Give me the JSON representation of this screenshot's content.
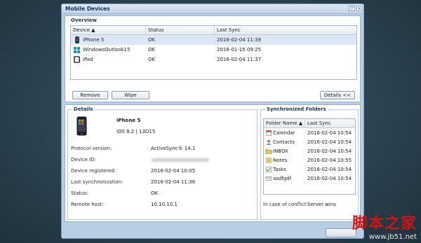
{
  "window": {
    "title": "Mobile Devices",
    "help_glyph": "?",
    "close_glyph": "×"
  },
  "overview": {
    "legend": "Overview",
    "columns": [
      "Device ▲",
      "Status",
      "Last Sync"
    ],
    "rows": [
      {
        "device": "iPhone 5",
        "status": "OK",
        "last_sync": "2016-02-04 11:39",
        "icon": "phone-icon"
      },
      {
        "device": "WindowsOutlook15",
        "status": "OK",
        "last_sync": "2016-01-15 09:25",
        "icon": "windows-icon"
      },
      {
        "device": "iPad",
        "status": "OK",
        "last_sync": "2016-02-04 11:37",
        "icon": "tablet-icon"
      }
    ],
    "remove_label": "Remove",
    "wipe_label": "Wipe",
    "details_label": "Details <<"
  },
  "details": {
    "legend": "Details",
    "device_name": "iPhone 5",
    "os": "iOS 8.2 | 13D15",
    "fields": [
      {
        "label": "Protocol version:",
        "value": "ActiveSync® 14.1"
      },
      {
        "label": "Device ID:",
        "value": ""
      },
      {
        "label": "Device registered:",
        "value": "2016-02-04 10:05"
      },
      {
        "label": "Last synchronization:",
        "value": "2016-02-04 11:38"
      },
      {
        "label": "Status:",
        "value": "OK"
      },
      {
        "label": "Remote host:",
        "value": "10.10.10.1"
      }
    ]
  },
  "sync_folders": {
    "legend": "Synchronized Folders",
    "columns": [
      "Folder Name ▲",
      "Last Sync"
    ],
    "rows": [
      {
        "name": "Calendar",
        "last_sync": "2016-02-04 10:54",
        "icon": "calendar-icon"
      },
      {
        "name": "Contacts",
        "last_sync": "2016-02-04 10:54",
        "icon": "contacts-icon"
      },
      {
        "name": "INBOX",
        "last_sync": "2016-02-04 10:54",
        "icon": "inbox-folder-icon"
      },
      {
        "name": "Notes",
        "last_sync": "2016-02-04 10:55",
        "icon": "notes-icon"
      },
      {
        "name": "Tasks",
        "last_sync": "2016-02-04 10:54",
        "icon": "tasks-icon"
      },
      {
        "name": "asdfgdf",
        "last_sync": "2016-02-04 10:54",
        "icon": "mail-folder-icon"
      }
    ],
    "conflict_label": "In case of conflict:",
    "conflict_value": "Server wins"
  },
  "watermark": {
    "line1": "脚本之家",
    "line2": "www.jb51.net"
  }
}
